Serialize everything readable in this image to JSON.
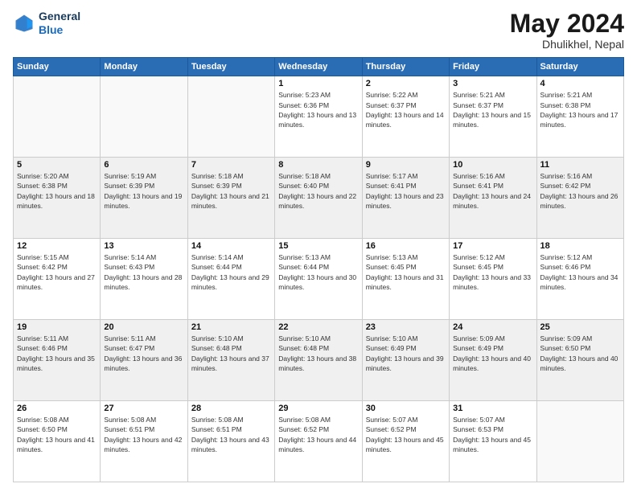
{
  "header": {
    "logo_line1": "General",
    "logo_line2": "Blue",
    "month": "May 2024",
    "location": "Dhulikhel, Nepal"
  },
  "weekdays": [
    "Sunday",
    "Monday",
    "Tuesday",
    "Wednesday",
    "Thursday",
    "Friday",
    "Saturday"
  ],
  "weeks": [
    [
      {
        "day": "",
        "sunrise": "",
        "sunset": "",
        "daylight": ""
      },
      {
        "day": "",
        "sunrise": "",
        "sunset": "",
        "daylight": ""
      },
      {
        "day": "",
        "sunrise": "",
        "sunset": "",
        "daylight": ""
      },
      {
        "day": "1",
        "sunrise": "Sunrise: 5:23 AM",
        "sunset": "Sunset: 6:36 PM",
        "daylight": "Daylight: 13 hours and 13 minutes."
      },
      {
        "day": "2",
        "sunrise": "Sunrise: 5:22 AM",
        "sunset": "Sunset: 6:37 PM",
        "daylight": "Daylight: 13 hours and 14 minutes."
      },
      {
        "day": "3",
        "sunrise": "Sunrise: 5:21 AM",
        "sunset": "Sunset: 6:37 PM",
        "daylight": "Daylight: 13 hours and 15 minutes."
      },
      {
        "day": "4",
        "sunrise": "Sunrise: 5:21 AM",
        "sunset": "Sunset: 6:38 PM",
        "daylight": "Daylight: 13 hours and 17 minutes."
      }
    ],
    [
      {
        "day": "5",
        "sunrise": "Sunrise: 5:20 AM",
        "sunset": "Sunset: 6:38 PM",
        "daylight": "Daylight: 13 hours and 18 minutes."
      },
      {
        "day": "6",
        "sunrise": "Sunrise: 5:19 AM",
        "sunset": "Sunset: 6:39 PM",
        "daylight": "Daylight: 13 hours and 19 minutes."
      },
      {
        "day": "7",
        "sunrise": "Sunrise: 5:18 AM",
        "sunset": "Sunset: 6:39 PM",
        "daylight": "Daylight: 13 hours and 21 minutes."
      },
      {
        "day": "8",
        "sunrise": "Sunrise: 5:18 AM",
        "sunset": "Sunset: 6:40 PM",
        "daylight": "Daylight: 13 hours and 22 minutes."
      },
      {
        "day": "9",
        "sunrise": "Sunrise: 5:17 AM",
        "sunset": "Sunset: 6:41 PM",
        "daylight": "Daylight: 13 hours and 23 minutes."
      },
      {
        "day": "10",
        "sunrise": "Sunrise: 5:16 AM",
        "sunset": "Sunset: 6:41 PM",
        "daylight": "Daylight: 13 hours and 24 minutes."
      },
      {
        "day": "11",
        "sunrise": "Sunrise: 5:16 AM",
        "sunset": "Sunset: 6:42 PM",
        "daylight": "Daylight: 13 hours and 26 minutes."
      }
    ],
    [
      {
        "day": "12",
        "sunrise": "Sunrise: 5:15 AM",
        "sunset": "Sunset: 6:42 PM",
        "daylight": "Daylight: 13 hours and 27 minutes."
      },
      {
        "day": "13",
        "sunrise": "Sunrise: 5:14 AM",
        "sunset": "Sunset: 6:43 PM",
        "daylight": "Daylight: 13 hours and 28 minutes."
      },
      {
        "day": "14",
        "sunrise": "Sunrise: 5:14 AM",
        "sunset": "Sunset: 6:44 PM",
        "daylight": "Daylight: 13 hours and 29 minutes."
      },
      {
        "day": "15",
        "sunrise": "Sunrise: 5:13 AM",
        "sunset": "Sunset: 6:44 PM",
        "daylight": "Daylight: 13 hours and 30 minutes."
      },
      {
        "day": "16",
        "sunrise": "Sunrise: 5:13 AM",
        "sunset": "Sunset: 6:45 PM",
        "daylight": "Daylight: 13 hours and 31 minutes."
      },
      {
        "day": "17",
        "sunrise": "Sunrise: 5:12 AM",
        "sunset": "Sunset: 6:45 PM",
        "daylight": "Daylight: 13 hours and 33 minutes."
      },
      {
        "day": "18",
        "sunrise": "Sunrise: 5:12 AM",
        "sunset": "Sunset: 6:46 PM",
        "daylight": "Daylight: 13 hours and 34 minutes."
      }
    ],
    [
      {
        "day": "19",
        "sunrise": "Sunrise: 5:11 AM",
        "sunset": "Sunset: 6:46 PM",
        "daylight": "Daylight: 13 hours and 35 minutes."
      },
      {
        "day": "20",
        "sunrise": "Sunrise: 5:11 AM",
        "sunset": "Sunset: 6:47 PM",
        "daylight": "Daylight: 13 hours and 36 minutes."
      },
      {
        "day": "21",
        "sunrise": "Sunrise: 5:10 AM",
        "sunset": "Sunset: 6:48 PM",
        "daylight": "Daylight: 13 hours and 37 minutes."
      },
      {
        "day": "22",
        "sunrise": "Sunrise: 5:10 AM",
        "sunset": "Sunset: 6:48 PM",
        "daylight": "Daylight: 13 hours and 38 minutes."
      },
      {
        "day": "23",
        "sunrise": "Sunrise: 5:10 AM",
        "sunset": "Sunset: 6:49 PM",
        "daylight": "Daylight: 13 hours and 39 minutes."
      },
      {
        "day": "24",
        "sunrise": "Sunrise: 5:09 AM",
        "sunset": "Sunset: 6:49 PM",
        "daylight": "Daylight: 13 hours and 40 minutes."
      },
      {
        "day": "25",
        "sunrise": "Sunrise: 5:09 AM",
        "sunset": "Sunset: 6:50 PM",
        "daylight": "Daylight: 13 hours and 40 minutes."
      }
    ],
    [
      {
        "day": "26",
        "sunrise": "Sunrise: 5:08 AM",
        "sunset": "Sunset: 6:50 PM",
        "daylight": "Daylight: 13 hours and 41 minutes."
      },
      {
        "day": "27",
        "sunrise": "Sunrise: 5:08 AM",
        "sunset": "Sunset: 6:51 PM",
        "daylight": "Daylight: 13 hours and 42 minutes."
      },
      {
        "day": "28",
        "sunrise": "Sunrise: 5:08 AM",
        "sunset": "Sunset: 6:51 PM",
        "daylight": "Daylight: 13 hours and 43 minutes."
      },
      {
        "day": "29",
        "sunrise": "Sunrise: 5:08 AM",
        "sunset": "Sunset: 6:52 PM",
        "daylight": "Daylight: 13 hours and 44 minutes."
      },
      {
        "day": "30",
        "sunrise": "Sunrise: 5:07 AM",
        "sunset": "Sunset: 6:52 PM",
        "daylight": "Daylight: 13 hours and 45 minutes."
      },
      {
        "day": "31",
        "sunrise": "Sunrise: 5:07 AM",
        "sunset": "Sunset: 6:53 PM",
        "daylight": "Daylight: 13 hours and 45 minutes."
      },
      {
        "day": "",
        "sunrise": "",
        "sunset": "",
        "daylight": ""
      }
    ]
  ]
}
